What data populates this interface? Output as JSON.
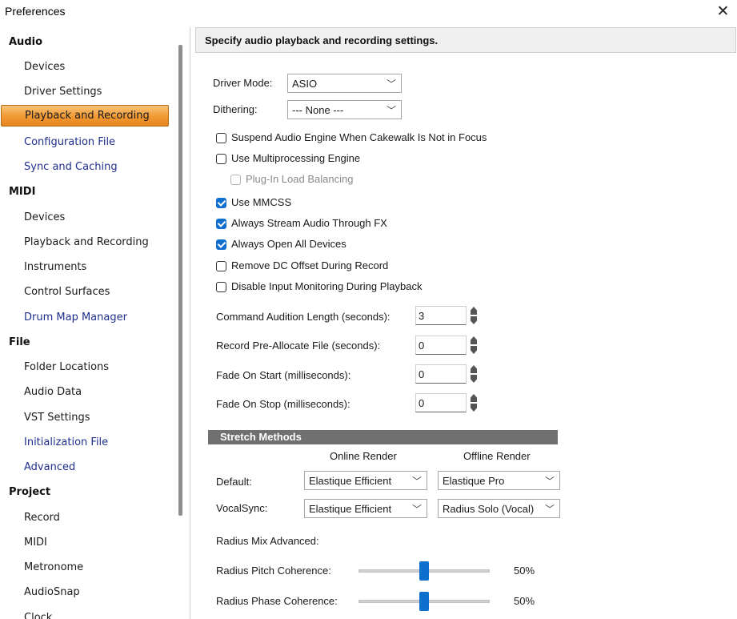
{
  "window": {
    "title": "Preferences",
    "close_glyph": "✕"
  },
  "sidebar": {
    "audio": {
      "label": "Audio",
      "items": [
        "Devices",
        "Driver Settings",
        "Playback and Recording",
        "Configuration File",
        "Sync and Caching"
      ]
    },
    "midi": {
      "label": "MIDI",
      "items": [
        "Devices",
        "Playback and Recording",
        "Instruments",
        "Control Surfaces",
        "Drum Map Manager"
      ]
    },
    "file": {
      "label": "File",
      "items": [
        "Folder Locations",
        "Audio Data",
        "VST Settings",
        "Initialization File",
        "Advanced"
      ]
    },
    "project": {
      "label": "Project",
      "items": [
        "Record",
        "MIDI",
        "Metronome",
        "AudioSnap",
        "Clock"
      ]
    },
    "selected": "Playback and Recording",
    "link_color": "#1f2f8c"
  },
  "panel": {
    "header": "Specify audio playback and recording settings.",
    "driver_mode": {
      "label": "Driver Mode:",
      "value": "ASIO"
    },
    "dithering": {
      "label": "Dithering:",
      "value": "--- None ---"
    },
    "checkboxes": {
      "suspend": {
        "label": "Suspend Audio Engine When Cakewalk Is Not in Focus",
        "checked": false
      },
      "multiproc": {
        "label": "Use Multiprocessing Engine",
        "checked": false
      },
      "plugin_balancing": {
        "label": "Plug-In Load Balancing",
        "checked": false,
        "disabled": true
      },
      "mmcss": {
        "label": "Use MMCSS",
        "checked": true
      },
      "stream_fx": {
        "label": "Always Stream Audio Through FX",
        "checked": true
      },
      "open_devices": {
        "label": "Always Open All Devices",
        "checked": true
      },
      "dc_offset": {
        "label": "Remove DC Offset During Record",
        "checked": false
      },
      "disable_monitoring": {
        "label": "Disable Input Monitoring During Playback",
        "checked": false
      }
    },
    "spinners": {
      "audition": {
        "label": "Command Audition Length (seconds):",
        "value": "3"
      },
      "preallocate": {
        "label": "Record Pre-Allocate File (seconds):",
        "value": "0"
      },
      "fade_start": {
        "label": "Fade On Start  (milliseconds):",
        "value": "0"
      },
      "fade_stop": {
        "label": "Fade On Stop  (milliseconds):",
        "value": "0"
      }
    },
    "stretch": {
      "title": "Stretch Methods",
      "online_header": "Online Render",
      "offline_header": "Offline Render",
      "default": {
        "label": "Default:",
        "online": "Elastique Efficient",
        "offline": "Elastique Pro"
      },
      "vocalsync": {
        "label": "VocalSync:",
        "online": "Elastique Efficient",
        "offline": "Radius Solo (Vocal)"
      },
      "radius_mix_label": "Radius Mix Advanced:",
      "pitch": {
        "label": "Radius Pitch Coherence:",
        "value": "50%",
        "fraction": 0.5
      },
      "phase": {
        "label": "Radius Phase Coherence:",
        "value": "50%",
        "fraction": 0.5
      }
    },
    "accent_color": "#0f6fcf",
    "selection_color": "#f19933"
  },
  "icons": {
    "dropdown": "chevron-down-icon",
    "close": "close-icon",
    "cursor": "mouse-pointer-icon"
  }
}
